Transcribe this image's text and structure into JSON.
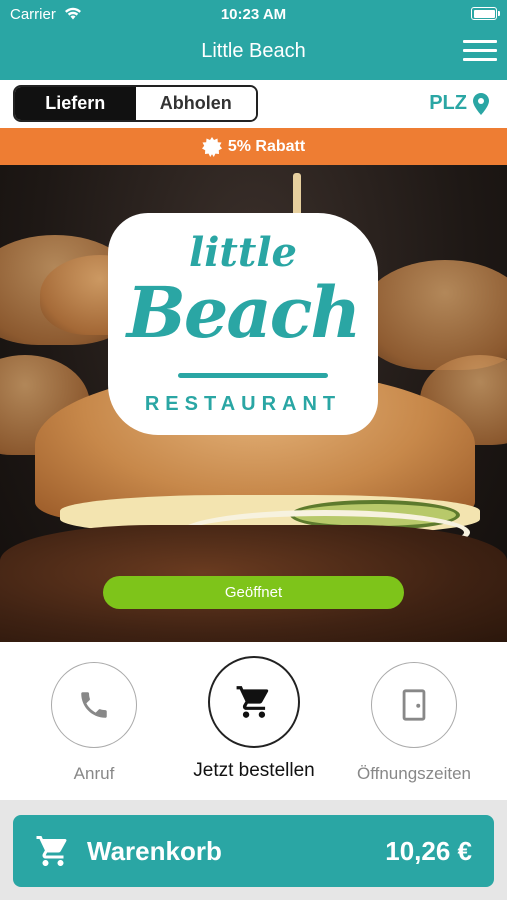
{
  "status_bar": {
    "carrier": "Carrier",
    "time": "10:23 AM"
  },
  "header": {
    "title": "Little Beach",
    "menu_icon": "hamburger-icon"
  },
  "order_mode": {
    "options": [
      "Liefern",
      "Abholen"
    ],
    "selected": "Liefern"
  },
  "plz": {
    "label": "PLZ",
    "icon": "location-pin-icon"
  },
  "promo": {
    "text": "5% Rabatt",
    "icon": "badge-star-icon"
  },
  "hero": {
    "logo_lines": [
      "little",
      "Beach",
      "RESTAURANT"
    ],
    "status": "Geöffnet"
  },
  "actions": [
    {
      "label": "Anruf",
      "icon": "phone-icon"
    },
    {
      "label": "Jetzt bestellen",
      "icon": "cart-icon"
    },
    {
      "label": "Öffnungszeiten",
      "icon": "door-icon"
    }
  ],
  "cart": {
    "label": "Warenkorb",
    "total": "10,26 €",
    "icon": "cart-icon"
  },
  "colors": {
    "accent": "#2aa6a4",
    "promo": "#ee7d33",
    "open": "#7ec41a"
  }
}
